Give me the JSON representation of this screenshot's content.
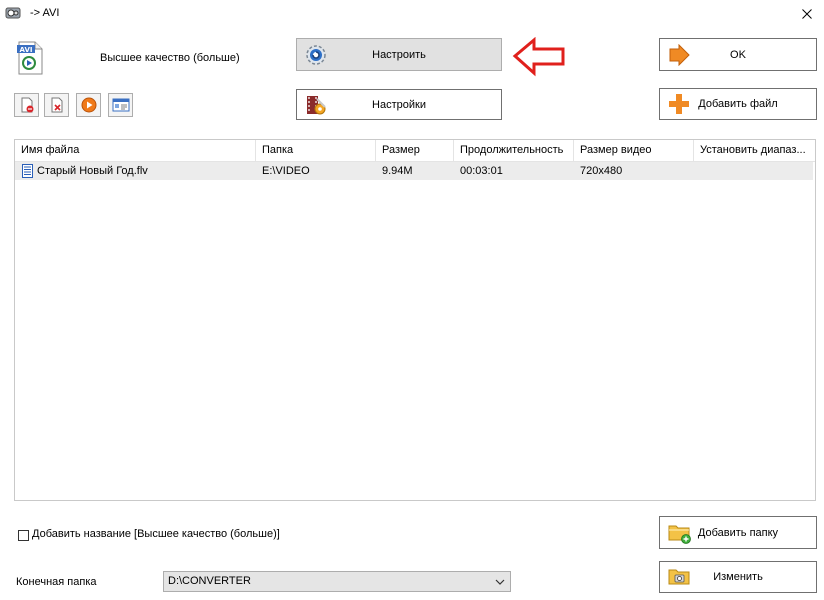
{
  "window": {
    "title": "-> AVI",
    "app_icon": "app-icon",
    "close_icon": "close-icon"
  },
  "preset": {
    "label": "Высшее качество (больше)",
    "icon": "avi-preset-icon",
    "badge": "AVI"
  },
  "buttons": {
    "configure": "Настроить",
    "settings": "Настройки",
    "ok": "OK",
    "add_file": "Добавить файл",
    "add_folder": "Добавить папку",
    "change": "Изменить"
  },
  "toolbar": {
    "icons": [
      "remove-file-icon",
      "delete-icon",
      "play-icon",
      "media-info-icon"
    ]
  },
  "grid": {
    "columns": [
      "Имя файла",
      "Папка",
      "Размер",
      "Продолжительность",
      "Размер видео",
      "Установить диапаз..."
    ],
    "rows": [
      {
        "name": "Старый Новый Год.flv",
        "folder": "E:\\VIDEO",
        "size": "9.94M",
        "duration": "00:03:01",
        "video_size": "720x480",
        "range": ""
      }
    ]
  },
  "options": {
    "add_name_label": "Добавить название [Высшее качество (больше)]",
    "add_name_checked": false
  },
  "destination": {
    "label": "Конечная папка",
    "value": "D:\\CONVERTER"
  },
  "colors": {
    "accent_red": "#e0201c",
    "orange": "#f5a623",
    "ok_arrow": "#f08a24"
  }
}
